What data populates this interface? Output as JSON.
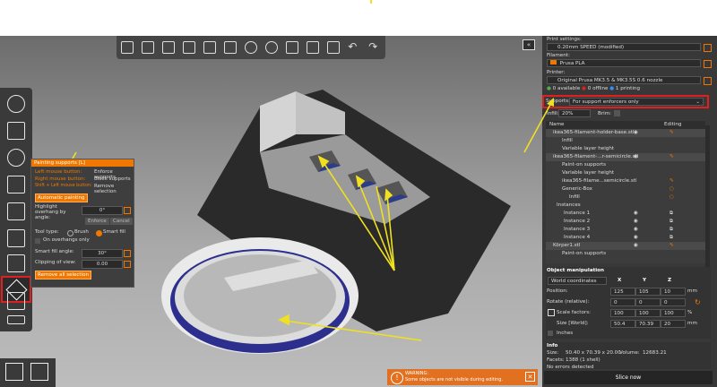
{
  "right_panel": {
    "print_settings_label": "Print settings:",
    "print_settings_value": "0.20mm SPEED (modified)",
    "filament_label": "Filament:",
    "filament_value": "Prusa PLA",
    "filament_color": "#f07800",
    "printer_label": "Printer:",
    "printer_value": "Original Prusa MK3.5 & MK3.5S 0.6 nozzle",
    "printer_status": [
      {
        "count": "0",
        "label": "available",
        "color": "#4caf50"
      },
      {
        "count": "0",
        "label": "offline",
        "color": "#e02020"
      },
      {
        "count": "1",
        "label": "printing",
        "color": "#3090ff"
      }
    ],
    "supports_label": "Supports:",
    "supports_value": "For support enforcers only",
    "infill_label": "Infill:",
    "infill_value": "20%",
    "brim_label": "Brim:",
    "tree_headers": {
      "name": "Name",
      "editing": "Editing"
    },
    "tree": [
      {
        "text": "ikea365-filament-holder-base.stl",
        "indent": 0
      },
      {
        "text": "Infill",
        "indent": 1
      },
      {
        "text": "Variable layer height",
        "indent": 1
      },
      {
        "text": "ikea365-filament-...r-semicircle.stl",
        "indent": 0
      },
      {
        "text": "Paint-on supports",
        "indent": 1
      },
      {
        "text": "Variable layer height",
        "indent": 1
      },
      {
        "text": "ikea365-filame...semicircle.stl",
        "indent": 1
      },
      {
        "text": "Generic-Box",
        "indent": 1
      },
      {
        "text": "Infill",
        "indent": 2
      },
      {
        "text": "Instances",
        "indent": 0
      },
      {
        "text": "Instance 1",
        "indent": 2
      },
      {
        "text": "Instance 2",
        "indent": 2
      },
      {
        "text": "Instance 3",
        "indent": 2
      },
      {
        "text": "Instance 4",
        "indent": 2
      },
      {
        "text": "Körper1.stl",
        "indent": 0
      },
      {
        "text": "Paint-on supports",
        "indent": 1
      }
    ],
    "object_manipulation": {
      "title": "Object manipulation",
      "coords_value": "World coordinates",
      "axes": [
        "X",
        "Y",
        "Z"
      ],
      "position_label": "Position:",
      "position": [
        "125",
        "105",
        "10"
      ],
      "rotate_label": "Rotate (relative):",
      "rotate": [
        "0",
        "0",
        "0"
      ],
      "scale_label": "Scale factors:",
      "scale": [
        "100",
        "100",
        "100"
      ],
      "size_label": "Size [World]:",
      "size": [
        "50.4",
        "70.39",
        "20"
      ],
      "unit_mm": "mm",
      "unit_pct": "%",
      "inches_label": "Inches"
    },
    "info": {
      "title": "Info",
      "size_label": "Size:",
      "size_value": "50.40 x 70.39 x 20.00",
      "volume_label": "Volume:",
      "volume_value": "12683.21",
      "facets_label": "Facets:",
      "facets_value": "1388 (1 shell)",
      "errors": "No errors detected"
    },
    "slice_button": "Slice now"
  },
  "paint_panel": {
    "title": "Painting supports [L]",
    "left_mouse": "Left mouse button:",
    "left_mouse_action": "Enforce supports",
    "right_mouse": "Right mouse button:",
    "right_mouse_action": "Block supports",
    "shift_left": "Shift + Left mouse button:",
    "shift_left_action": "Remove selection",
    "auto_paint": "Automatic painting",
    "highlight_label": "Highlight overhang by angle:",
    "highlight_value": "0°",
    "enforce_btn": "Enforce",
    "cancel_btn": "Cancel",
    "tool_type_label": "Tool type:",
    "brush_label": "Brush",
    "smart_fill_label": "Smart fill",
    "on_overhangs_label": "On overhangs only",
    "smart_fill_angle_label": "Smart fill angle:",
    "smart_fill_angle_value": "30°",
    "clipping_label": "Clipping of view:",
    "clipping_value": "0.00",
    "remove_all": "Remove all selection"
  },
  "warning": {
    "title": "WARNING:",
    "text": "Some objects are not visible during editing."
  },
  "colors": {
    "accent": "#f07800",
    "annotation": "#f0e020",
    "highlight": "#e02020"
  }
}
